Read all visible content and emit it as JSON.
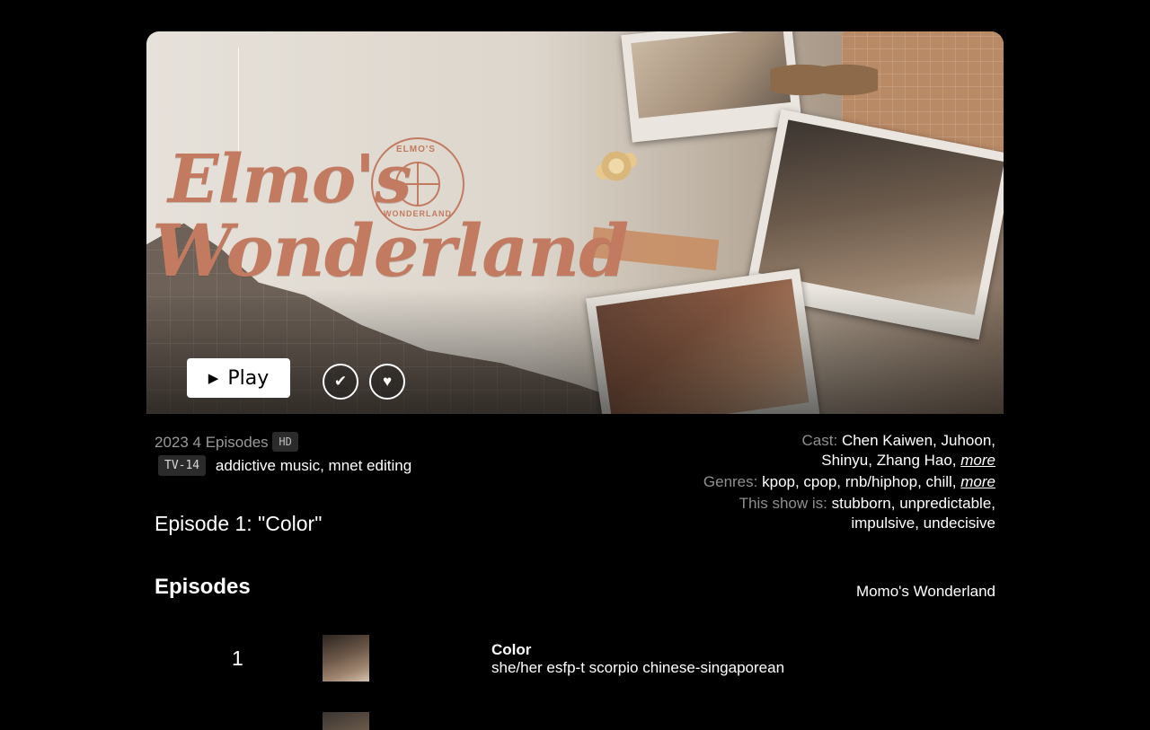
{
  "hero": {
    "title_line1": "Elmo's",
    "title_line2": "Wonderland",
    "seal_top": "ELMO'S",
    "seal_bottom": "WONDERLAND",
    "play_label": "Play",
    "play_icon": "play-icon",
    "check_icon": "check-icon",
    "heart_icon": "heart-icon"
  },
  "meta": {
    "year_episodes": "2023 4 Episodes",
    "quality_badge": "HD",
    "rating_badge": "TV-14",
    "tags": "addictive music, mnet editing"
  },
  "current_episode": "Episode 1: \"Color\"",
  "details": {
    "cast_label": "Cast:",
    "cast_line1": "Chen Kaiwen, Juhoon,",
    "cast_line2": "Shinyu, Zhang Hao,",
    "genres_label": "Genres:",
    "genres": "kpop, cpop, rnb/hiphop, chill,",
    "show_is_label": "This show is:",
    "show_is_line1": "stubborn, unpredictable,",
    "show_is_line2": "impulsive, undecisive",
    "more_label": "more"
  },
  "episodes": {
    "heading": "Episodes",
    "series_name": "Momo's Wonderland",
    "items": [
      {
        "number": "1",
        "title": "Color",
        "description": "she/her esfp-t scorpio chinese-singaporean"
      }
    ]
  },
  "colors": {
    "accent_title": "#c27b60",
    "background": "#000000"
  }
}
